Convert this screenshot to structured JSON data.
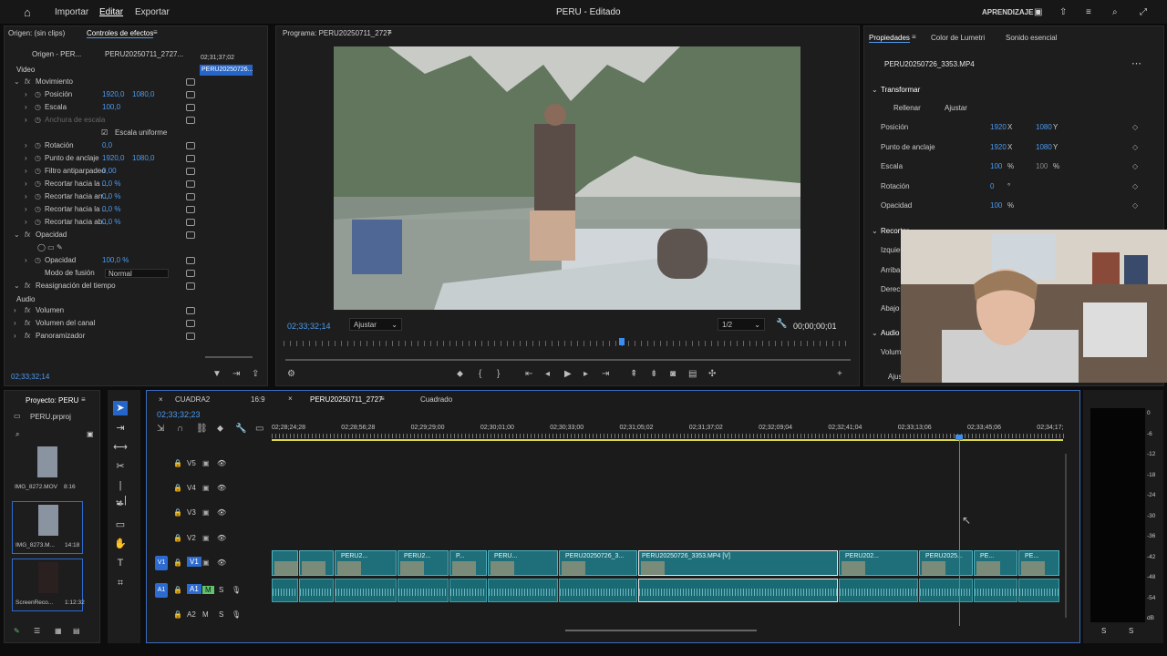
{
  "topbar": {
    "nav": [
      "Importar",
      "Editar",
      "Exportar"
    ],
    "title": "PERU - Editado",
    "learn": "APRENDIZAJE"
  },
  "source": {
    "origin": "Origen: (sin clips)",
    "tab": "Controles de efectos",
    "origin_tab": "Origen - PER...",
    "clip_tab": "PERU20250711_2727...",
    "time": "02;31;37;02",
    "clip_name": "PERU20250726...",
    "section_video": "Video",
    "section_audio": "Audio",
    "timecode": "02;33;32;14"
  },
  "effects": [
    {
      "label": "Movimiento",
      "fx": true,
      "indent": 0
    },
    {
      "label": "Posición",
      "v1": "1920,0",
      "v2": "1080,0",
      "indent": 1
    },
    {
      "label": "Escala",
      "v1": "100,0",
      "indent": 1
    },
    {
      "label": "Anchura de escala",
      "indent": 1,
      "dim": true
    },
    {
      "label": "Escala uniforme",
      "check": true,
      "indent": 2
    },
    {
      "label": "Rotación",
      "v1": "0,0",
      "indent": 1
    },
    {
      "label": "Punto de anclaje",
      "v1": "1920,0",
      "v2": "1080,0",
      "indent": 1
    },
    {
      "label": "Filtro antiparpadeo",
      "v1": "0,00",
      "indent": 1
    },
    {
      "label": "Recortar hacia la ...",
      "v1": "0,0 %",
      "indent": 1
    },
    {
      "label": "Recortar hacia arr...",
      "v1": "0,0 %",
      "indent": 1
    },
    {
      "label": "Recortar hacia la ...",
      "v1": "0,0 %",
      "indent": 1
    },
    {
      "label": "Recortar hacia ab...",
      "v1": "0,0 %",
      "indent": 1
    },
    {
      "label": "Opacidad",
      "fx": true,
      "indent": 0
    },
    {
      "label": "",
      "shapes": true,
      "indent": 1
    },
    {
      "label": "Opacidad",
      "v1": "100,0 %",
      "indent": 1
    },
    {
      "label": "Modo de fusión",
      "select": "Normal",
      "indent": 1
    },
    {
      "label": "Reasignación del tiempo",
      "fx": true,
      "indent": 0
    }
  ],
  "audio_effects": [
    "Volumen",
    "Volumen del canal",
    "Panoramizador"
  ],
  "program": {
    "title": "Programa: PERU20250711_2727",
    "timecode": "02;33;32;14",
    "fit": "Ajustar",
    "quality": "1/2",
    "duration": "00;00;00;01"
  },
  "props": {
    "tabs": [
      "Propiedades",
      "Color de Lumetri",
      "Sonido esencial"
    ],
    "clip": "PERU20250726_3353.MP4",
    "section": "Transformar",
    "fill": "Rellenar",
    "fit": "Ajustar",
    "rows": [
      {
        "label": "Posición",
        "x": "1920",
        "xl": "X",
        "y": "1080",
        "yl": "Y"
      },
      {
        "label": "Punto de anclaje",
        "x": "1920",
        "xl": "X",
        "y": "1080",
        "yl": "Y"
      },
      {
        "label": "Escala",
        "x": "100",
        "xl": "%",
        "y": "100",
        "yl": "%"
      },
      {
        "label": "Rotación",
        "x": "0",
        "xl": "°"
      },
      {
        "label": "Opacidad",
        "x": "100",
        "xl": "%"
      }
    ],
    "crop": "Recortar",
    "crop_items": [
      "Izquier",
      "Arriba",
      "Derech",
      "Abajo"
    ],
    "audio": "Audio",
    "volume": "Volum",
    "adjust": "Ajus"
  },
  "project": {
    "title": "Proyecto: PERU",
    "file": "PERU.prproj",
    "items": [
      {
        "name": "IMG_8272.MOV",
        "dur": "8:16"
      },
      {
        "name": "IMG_8273.M...",
        "dur": "14:18"
      },
      {
        "name": "ScreenReco...",
        "dur": "1:12:32"
      }
    ]
  },
  "timeline": {
    "tabs": [
      "CUADRA2",
      "16:9",
      "PERU20250711_2727",
      "Cuadrado"
    ],
    "timecode": "02;33;32;23",
    "ruler": [
      "02;28;24;28",
      "02;28;56;28",
      "02;29;29;00",
      "02;30;01;00",
      "02;30;33;00",
      "02;31;05;02",
      "02;31;37;02",
      "02;32;09;04",
      "02;32;41;04",
      "02;33;13;06",
      "02;33;45;06",
      "02;34;17;"
    ],
    "tracks": [
      "V5",
      "V4",
      "V3",
      "V2",
      "V1",
      "A1",
      "A2"
    ],
    "clips": [
      "PERU2...",
      "PERU2...",
      "P...",
      "PERU...",
      "PERU20250726_3...",
      "PERU20250726_3353.MP4 [V]",
      "PERU202...",
      "PERU2025...",
      "PE...",
      "PE..."
    ]
  },
  "meter": {
    "ticks": [
      "0",
      "-6",
      "-12",
      "-18",
      "-24",
      "-30",
      "-36",
      "-42",
      "-48",
      "-54",
      "dB"
    ],
    "labels": [
      "S",
      "S"
    ]
  },
  "colors": {
    "accent": "#4d9bf0",
    "clip": "#1f6f7a",
    "playhead": "#3b8df0"
  }
}
